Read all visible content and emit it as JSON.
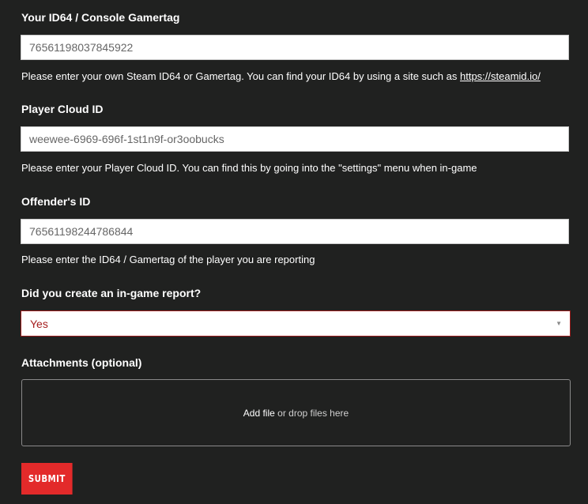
{
  "fields": {
    "id64": {
      "label": "Your ID64 / Console Gamertag",
      "value": "76561198037845922",
      "help_text": "Please enter your own Steam ID64 or Gamertag. You can find your ID64 by using a site such as ",
      "help_link": "https://steamid.io/"
    },
    "cloud_id": {
      "label": "Player Cloud ID",
      "value": "weewee-6969-696f-1st1n9f-or3oobucks",
      "help_text": "Please enter your Player Cloud ID. You can find this by going into the \"settings\" menu when in-game"
    },
    "offender_id": {
      "label": "Offender's ID",
      "value": "76561198244786844",
      "help_text": "Please enter the ID64 / Gamertag of the player you are reporting"
    },
    "ingame_report": {
      "label": "Did you create an in-game report?",
      "selected": "Yes"
    },
    "attachments": {
      "label": "Attachments (optional)",
      "add_file": "Add file",
      "drop_text": " or drop files here"
    }
  },
  "submit_label": "SUBMIT",
  "colors": {
    "background": "#202120",
    "accent": "#e32a2a",
    "select_border": "#9c1c1c",
    "select_text": "#a51e1e"
  }
}
